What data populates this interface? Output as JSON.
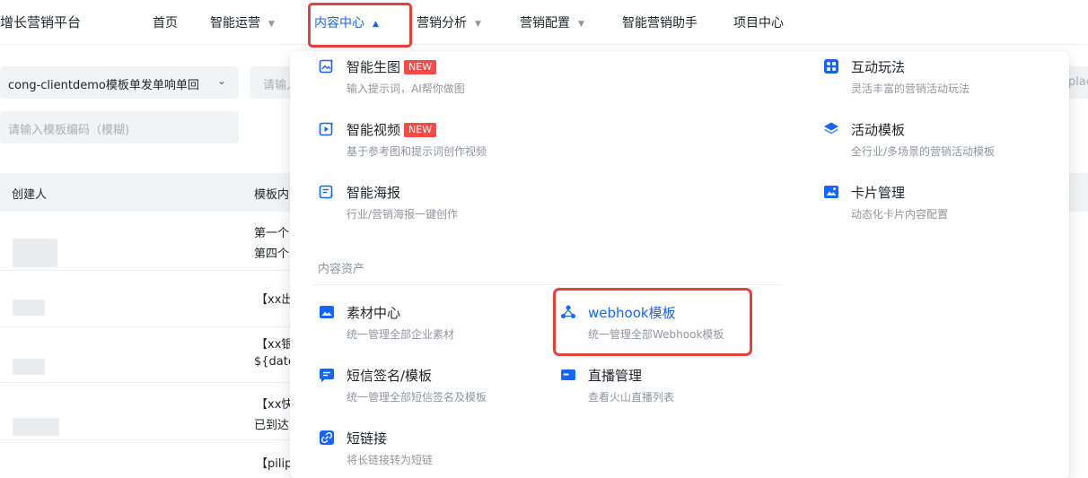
{
  "nav": {
    "brand": "增长营销平台",
    "items": [
      {
        "label": "首页",
        "has_caret": false
      },
      {
        "label": "智能运营",
        "has_caret": true
      },
      {
        "label": "内容中心",
        "has_caret": true,
        "active": true
      },
      {
        "label": "营销分析",
        "has_caret": true
      },
      {
        "label": "营销配置",
        "has_caret": true
      },
      {
        "label": "智能营销助手",
        "has_caret": false
      },
      {
        "label": "项目中心",
        "has_caret": false
      }
    ]
  },
  "filters": {
    "select_value": "cong-clientdemo模板单发单响单回",
    "input2_placeholder": "请输入",
    "template_code_placeholder": "请输入模板编码（模糊)",
    "right_placeholder": "plac"
  },
  "table": {
    "columns": [
      "创建人",
      "模板内"
    ],
    "rows": [
      [
        "第一个",
        "第四个"
      ],
      [
        "【xx出"
      ],
      [
        "【xx银",
        "${date"
      ],
      [
        "【xx快",
        "已到达"
      ],
      [
        "【pilip"
      ]
    ]
  },
  "dropdown": {
    "col1": [
      {
        "title": "智能生图",
        "badge": "NEW",
        "desc": "输入提示词，AI帮你做图",
        "icon": "ai-image-icon"
      },
      {
        "title": "智能视频",
        "badge": "NEW",
        "desc": "基于参考图和提示词创作视频",
        "icon": "ai-video-icon"
      },
      {
        "title": "智能海报",
        "badge": "",
        "desc": "行业/营销海报一键创作",
        "icon": "ai-poster-icon"
      }
    ],
    "col3": [
      {
        "title": "互动玩法",
        "desc": "灵活丰富的营销活动玩法",
        "icon": "interactive-icon"
      },
      {
        "title": "活动模板",
        "desc": "全行业/多场景的营销活动模板",
        "icon": "layers-icon"
      },
      {
        "title": "卡片管理",
        "desc": "动态化卡片内容配置",
        "icon": "card-icon"
      }
    ],
    "section_title": "内容资产",
    "assets_col1": [
      {
        "title": "素材中心",
        "desc": "统一管理全部企业素材",
        "icon": "image-library-icon"
      },
      {
        "title": "短信签名/模板",
        "desc": "统一管理全部短信签名及模板",
        "icon": "sms-icon"
      },
      {
        "title": "短链接",
        "desc": "将长链接转为短链",
        "icon": "link-icon"
      }
    ],
    "assets_col2": [
      {
        "title": "webhook模板",
        "desc": "统一管理全部Webhook模板",
        "icon": "webhook-icon",
        "active": true
      },
      {
        "title": "直播管理",
        "desc": "查看火山直播列表",
        "icon": "live-icon"
      }
    ]
  },
  "colors": {
    "accent": "#1664ff",
    "highlight": "#e5403c",
    "badge": "#f54a45"
  }
}
